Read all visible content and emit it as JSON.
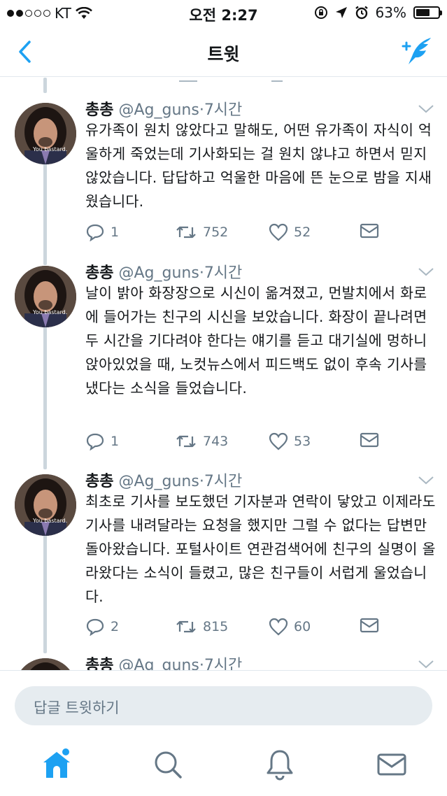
{
  "status_bar": {
    "carrier": "KT",
    "time": "오전 2:27",
    "battery_percent": "63%",
    "battery_level": 0.63
  },
  "nav": {
    "title": "트윗",
    "back_icon": "chevron-left-icon",
    "compose_icon": "compose-tweet-icon",
    "accent_color": "#1da1f2"
  },
  "tweets": [
    {
      "name": "총총",
      "handle": "@Ag_guns",
      "time": "7시간",
      "avatar_caption": "You bastard.",
      "text": "유가족이 원치 않았다고 말해도, 어떤 유가족이 자식이 억울하게 죽었는데 기사화되는 걸 원치 않냐고 하면서 믿지 않았습니다. 답답하고 억울한 마음에 뜬 눈으로 밤을 지새웠습니다.",
      "replies": "1",
      "retweets": "752",
      "likes": "52"
    },
    {
      "name": "총총",
      "handle": "@Ag_guns",
      "time": "7시간",
      "avatar_caption": "You bastard.",
      "text": "날이 밝아 화장장으로 시신이 옮겨졌고, 먼발치에서 화로에 들어가는 친구의 시신을 보았습니다. 화장이 끝나려면 두 시간을 기다려야 한다는 얘기를 듣고 대기실에 멍하니 앉아있었을 때, 노컷뉴스에서 피드백도 없이 후속 기사를 냈다는 소식을 들었습니다.",
      "replies": "1",
      "retweets": "743",
      "likes": "53"
    },
    {
      "name": "총총",
      "handle": "@Ag_guns",
      "time": "7시간",
      "avatar_caption": "You bastard.",
      "text": "최초로 기사를 보도했던 기자분과 연락이 닿았고 이제라도 기사를 내려달라는 요청을 했지만 그럴 수 없다는 답변만 돌아왔습니다. 포털사이트 연관검색어에 친구의 실명이 올라왔다는 소식이 들렸고, 많은 친구들이 서럽게 울었습니다.",
      "replies": "2",
      "retweets": "815",
      "likes": "60"
    },
    {
      "name": "총총",
      "handle": "@Ag_guns",
      "time": "7시간"
    }
  ],
  "reply_bar": {
    "placeholder": "답글 트윗하기"
  },
  "tab_bar": {
    "home_icon": "home-icon",
    "search_icon": "search-icon",
    "notifications_icon": "bell-icon",
    "messages_icon": "mail-icon"
  }
}
